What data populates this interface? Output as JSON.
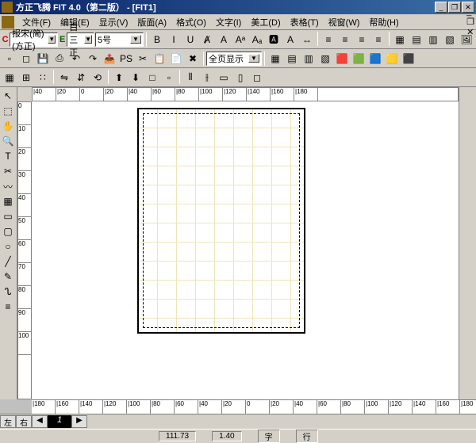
{
  "title": "方正飞腾 FIT 4.0（第二版） - [FIT1]",
  "window_buttons": {
    "min": "_",
    "max": "❐",
    "close": "✕"
  },
  "menu": [
    "文件(F)",
    "编辑(E)",
    "显示(V)",
    "版面(A)",
    "格式(O)",
    "文字(I)",
    "美工(D)",
    "表格(T)",
    "视窗(W)",
    "帮助(H)"
  ],
  "fontbar": {
    "c_label": "C",
    "font1": "报宋(简)(方正)",
    "e_label": "E",
    "font2": "白三正",
    "size": "5号",
    "zoom": "全页显示"
  },
  "tb1_icons": [
    "new-icon",
    "open-icon",
    "save-icon",
    "saveall-icon",
    "undo-icon",
    "redo-icon",
    "export-icon",
    "ps-icon",
    "cut-icon",
    "copy-icon",
    "paste-icon",
    "delete-icon"
  ],
  "tb1_glyphs": [
    "▫",
    "◻",
    "💾",
    "⎙",
    "↶",
    "↷",
    "📤",
    "PS",
    "✂",
    "📋",
    "📄",
    "✖"
  ],
  "fmt_icons": [
    "bold",
    "italic",
    "underline",
    "strike",
    "outline",
    "super",
    "sub",
    "box-a",
    "inv-a",
    "spacing",
    "sep",
    "align-l",
    "align-c",
    "align-r",
    "align-j",
    "sep",
    "grid1",
    "grid2",
    "grid3",
    "grid4",
    "img"
  ],
  "fmt_glyphs": [
    "B",
    "I",
    "U",
    "Ⱥ",
    "A",
    "Aᵃ",
    "Aₐ",
    "🅰",
    "A",
    "↔",
    "",
    "≡",
    "≡",
    "≡",
    "≡",
    "",
    "▦",
    "▤",
    "▥",
    "▧",
    "🖼"
  ],
  "tb3_icons": [
    "grid",
    "snap",
    "guides",
    "sep",
    "flip-h",
    "flip-v",
    "rotate",
    "sep",
    "layer-up",
    "layer-dn",
    "group",
    "ungroup",
    "sep",
    "dist-h",
    "dist-v",
    "align1",
    "align2",
    "align3"
  ],
  "tb3_glyphs": [
    "▦",
    "⊞",
    "∷",
    "",
    "⇋",
    "⇵",
    "⟲",
    "",
    "⬆",
    "⬇",
    "□",
    "▫",
    "",
    "⫴",
    "⫲",
    "▭",
    "▯",
    "◻"
  ],
  "vtools": [
    "pointer",
    "select",
    "pan",
    "zoom",
    "text",
    "crop",
    "curve",
    "table",
    "rect",
    "roundrect",
    "ellipse",
    "line",
    "pen",
    "free",
    "para"
  ],
  "vtool_glyphs": [
    "↖",
    "⬚",
    "✋",
    "🔍",
    "T",
    "✂",
    "〰",
    "▦",
    "▭",
    "▢",
    "○",
    "╱",
    "✎",
    "ᔐ",
    "≡"
  ],
  "hruler": [
    "|40",
    "|20",
    "0",
    "|20",
    "|40",
    "|60",
    "|80",
    "|100",
    "|120",
    "|140",
    "|160",
    "|180"
  ],
  "vruler": [
    "0",
    "10",
    "20",
    "30",
    "40",
    "50",
    "60",
    "70",
    "80",
    "90",
    "100"
  ],
  "pruler": [
    "|180",
    "|160",
    "|140",
    "|120",
    "|100",
    "|80",
    "|60",
    "|40",
    "|20",
    "0",
    "|20",
    "|40",
    "|60",
    "|80",
    "|100",
    "|120",
    "|140",
    "|160",
    "|180"
  ],
  "pages": {
    "left": "左",
    "right": "右",
    "prev": "◀",
    "num": "1",
    "next": "▶"
  },
  "status": {
    "x": "111.73",
    "y": "1.40",
    "unit": "字",
    "mode": "行"
  }
}
